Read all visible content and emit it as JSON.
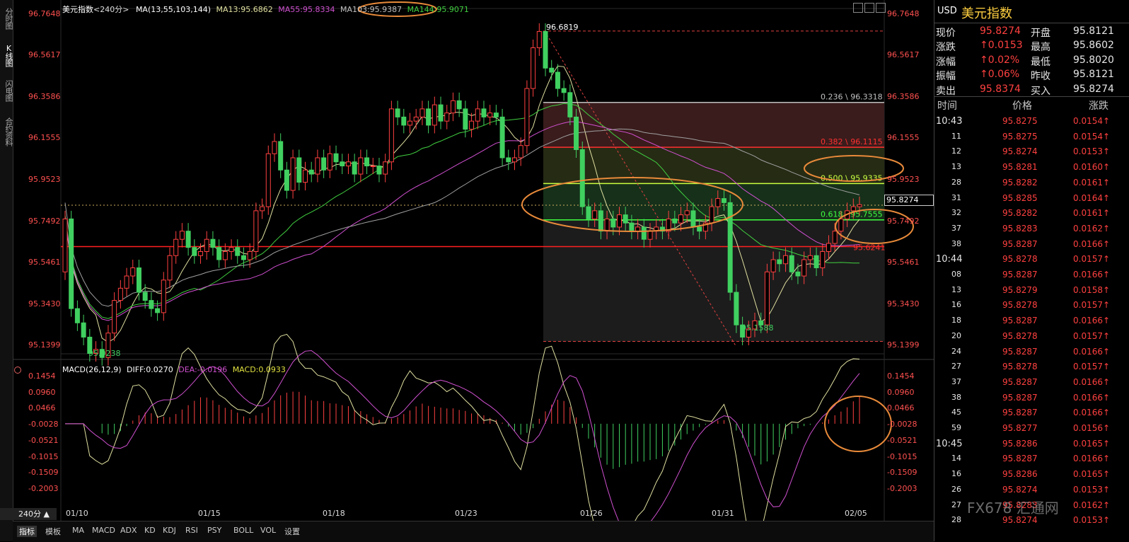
{
  "left_tabs": [
    "分时图",
    "K线图",
    "闪电图",
    "合约资料"
  ],
  "main": {
    "title": "美元指数",
    "period_tag": "<240分>",
    "ma_params": "MA(13,55,103,144)",
    "ma13": "MA13:95.6862",
    "ma55": "MA55:95.8334",
    "ma103": "MA103:95.9387",
    "ma144": "MA144:95.9071",
    "y_ticks": [
      "96.7648",
      "96.5617",
      "96.3586",
      "96.1555",
      "95.9523",
      "95.7492",
      "95.5461",
      "95.3430",
      "95.1399"
    ],
    "high_label": "96.6819",
    "low_label": "95.1588",
    "start_low_label": "95.0238",
    "last_price": "95.8274",
    "fib": [
      {
        "ratio": "0.236",
        "value": "96.3318"
      },
      {
        "ratio": "0.382",
        "value": "96.1115"
      },
      {
        "ratio": "0.500",
        "value": "95.9335"
      },
      {
        "ratio": "0.618",
        "value": "95.7555"
      }
    ],
    "support_label": "95.6241"
  },
  "macd": {
    "params": "MACD(26,12,9)",
    "diff": "DIFF:0.0270",
    "dea": "DEA:-0.0196",
    "macd": "MACD:0.0933",
    "y_ticks": [
      "0.1454",
      "0.0960",
      "0.0466",
      "-0.0028",
      "-0.0521",
      "-0.1015",
      "-0.1509",
      "-0.2003"
    ]
  },
  "x_labels": [
    "01/10",
    "01/15",
    "01/18",
    "01/23",
    "01/26",
    "01/31",
    "02/05"
  ],
  "period_button": "240分 ▲",
  "bottom_tabs": [
    "指标",
    "模板",
    "MA",
    "MACD",
    "ADX",
    "KD",
    "KDJ",
    "RSI",
    "PSY",
    "BOLL",
    "VOL",
    "设置"
  ],
  "panel": {
    "code": "USD",
    "name": "美元指数",
    "quote": [
      {
        "l1": "现价",
        "v1": "95.8274",
        "l2": "开盘",
        "v2": "95.8121"
      },
      {
        "l1": "涨跌",
        "v1": "↑0.0153",
        "l2": "最高",
        "v2": "95.8602"
      },
      {
        "l1": "涨幅",
        "v1": "↑0.02%",
        "l2": "最低",
        "v2": "95.8020"
      },
      {
        "l1": "振幅",
        "v1": "↑0.06%",
        "l2": "昨收",
        "v2": "95.8121"
      },
      {
        "l1": "卖出",
        "v1": "95.8374",
        "l2": "买入",
        "v2": "95.8274"
      }
    ],
    "tick_headers": [
      "时间",
      "价格",
      "涨跌"
    ],
    "ticks": [
      {
        "t": "10:43",
        "p": "95.8275",
        "c": "0.0154↑"
      },
      {
        "t": "11",
        "p": "95.8275",
        "c": "0.0154↑"
      },
      {
        "t": "12",
        "p": "95.8274",
        "c": "0.0153↑"
      },
      {
        "t": "13",
        "p": "95.8281",
        "c": "0.0160↑"
      },
      {
        "t": "28",
        "p": "95.8282",
        "c": "0.0161↑"
      },
      {
        "t": "31",
        "p": "95.8285",
        "c": "0.0164↑"
      },
      {
        "t": "32",
        "p": "95.8282",
        "c": "0.0161↑"
      },
      {
        "t": "37",
        "p": "95.8283",
        "c": "0.0162↑"
      },
      {
        "t": "38",
        "p": "95.8287",
        "c": "0.0166↑"
      },
      {
        "t": "10:44",
        "p": "95.8278",
        "c": "0.0157↑"
      },
      {
        "t": "08",
        "p": "95.8287",
        "c": "0.0166↑"
      },
      {
        "t": "13",
        "p": "95.8279",
        "c": "0.0158↑"
      },
      {
        "t": "16",
        "p": "95.8278",
        "c": "0.0157↑"
      },
      {
        "t": "18",
        "p": "95.8287",
        "c": "0.0166↑"
      },
      {
        "t": "20",
        "p": "95.8278",
        "c": "0.0157↑"
      },
      {
        "t": "24",
        "p": "95.8287",
        "c": "0.0166↑"
      },
      {
        "t": "27",
        "p": "95.8278",
        "c": "0.0157↑"
      },
      {
        "t": "37",
        "p": "95.8287",
        "c": "0.0166↑"
      },
      {
        "t": "38",
        "p": "95.8287",
        "c": "0.0166↑"
      },
      {
        "t": "45",
        "p": "95.8287",
        "c": "0.0166↑"
      },
      {
        "t": "59",
        "p": "95.8277",
        "c": "0.0156↑"
      },
      {
        "t": "10:45",
        "p": "95.8286",
        "c": "0.0165↑"
      },
      {
        "t": "14",
        "p": "95.8287",
        "c": "0.0166↑"
      },
      {
        "t": "16",
        "p": "95.8286",
        "c": "0.0165↑"
      },
      {
        "t": "26",
        "p": "95.8274",
        "c": "0.0153↑"
      },
      {
        "t": "27",
        "p": "95.8283",
        "c": "0.0162↑"
      },
      {
        "t": "28",
        "p": "95.8274",
        "c": "0.0153↑"
      }
    ],
    "watermark": "FX678 汇通网"
  },
  "colors": {
    "up": "#ff4040",
    "down": "#40d060",
    "fib_red": "#ff3030",
    "fib_yellow": "#c8ff40",
    "fib_green": "#40ff40",
    "circle": "#e88a3a"
  }
}
